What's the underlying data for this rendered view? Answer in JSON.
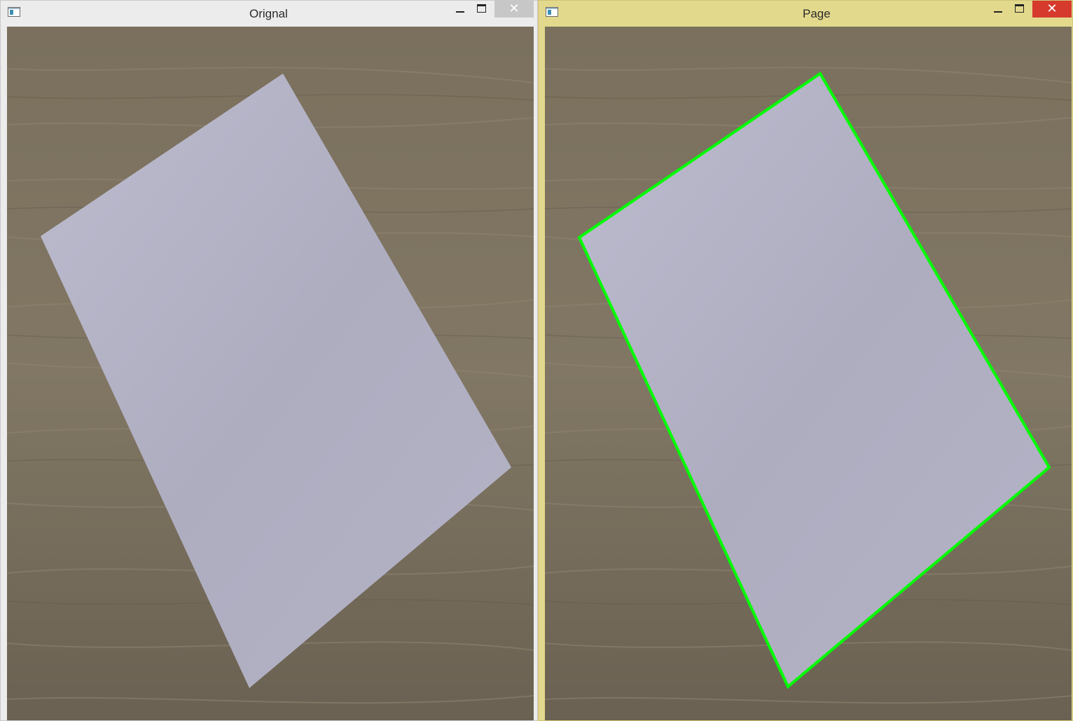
{
  "windows": [
    {
      "title": "Orignal",
      "close_symbol": "✕",
      "icons": [
        "app-window-icon",
        "minimize-icon",
        "maximize-icon",
        "close-icon"
      ],
      "image": "sheet of white paper on wooden table"
    },
    {
      "title": "Page",
      "close_symbol": "✕",
      "icons": [
        "app-window-icon",
        "minimize-icon",
        "maximize-icon",
        "close-icon"
      ],
      "image": "sheet of white paper on wooden table with detected page contour",
      "contour_color": "#00ff00"
    }
  ],
  "colors": {
    "wood_base": "#7e7563",
    "wood_light": "#8f8571",
    "wood_dark": "#625a4d",
    "paper": "#aeadbf",
    "paper_light": "#bcbbcd",
    "page_window_frame": "#e3d98d",
    "close_button_active": "#d63a2d"
  }
}
